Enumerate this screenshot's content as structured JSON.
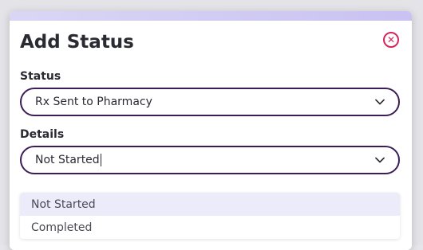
{
  "dialog": {
    "title": "Add Status",
    "close_icon": "close-icon"
  },
  "status_field": {
    "label": "Status",
    "value": "Rx Sent to Pharmacy"
  },
  "details_field": {
    "label": "Details",
    "value": "Not Started"
  },
  "details_options": [
    {
      "label": "Not Started",
      "highlighted": true
    },
    {
      "label": "Completed",
      "highlighted": false
    }
  ],
  "colors": {
    "accent": "#3b1d57",
    "close": "#d6265c",
    "highlight": "#ecebfa"
  }
}
